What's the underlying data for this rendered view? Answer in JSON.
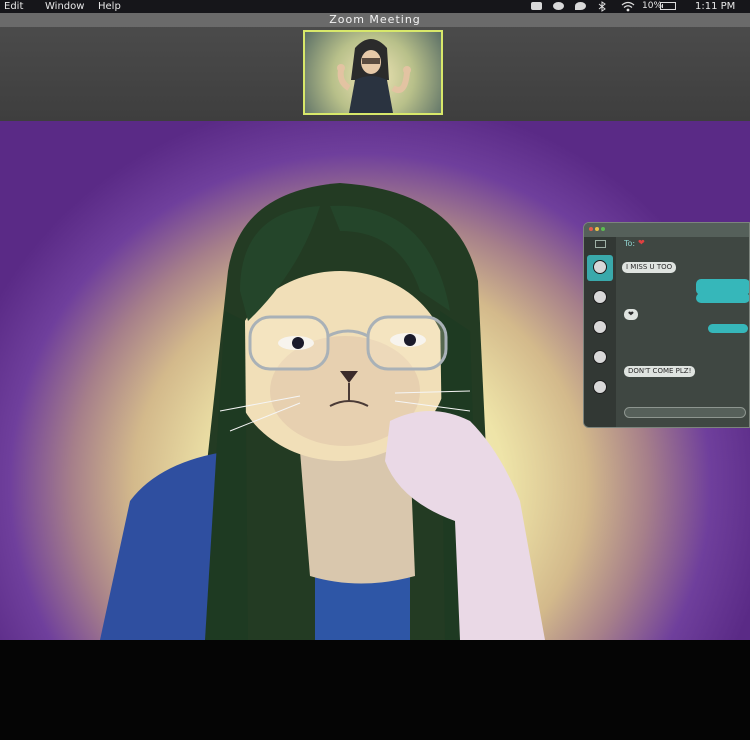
{
  "menubar": {
    "items": [
      "Edit",
      "Window",
      "Help"
    ],
    "battery_percent": "10%",
    "battery_level": 0.1,
    "clock": "1:11 PM",
    "status_icons": [
      "camera-icon",
      "chat-bubble-icon",
      "messages-icon",
      "bluetooth-icon",
      "wifi-icon",
      "battery-icon"
    ]
  },
  "zoom": {
    "title": "Zoom   Meeting"
  },
  "chat": {
    "to_label": "To:",
    "to_icon": "heart-icon",
    "messages": [
      {
        "direction": "in",
        "text": "I MISS U TOO"
      },
      {
        "direction": "out",
        "text": ""
      },
      {
        "direction": "out",
        "text": ""
      },
      {
        "direction": "in",
        "text": "❤"
      },
      {
        "direction": "out",
        "text": ""
      },
      {
        "direction": "in",
        "text": "DON'T COME PLZ!"
      }
    ],
    "input_value": ""
  },
  "colors": {
    "accent": "#36b7ba",
    "self_view_border": "#d8e86a",
    "heart": "#e04040"
  }
}
